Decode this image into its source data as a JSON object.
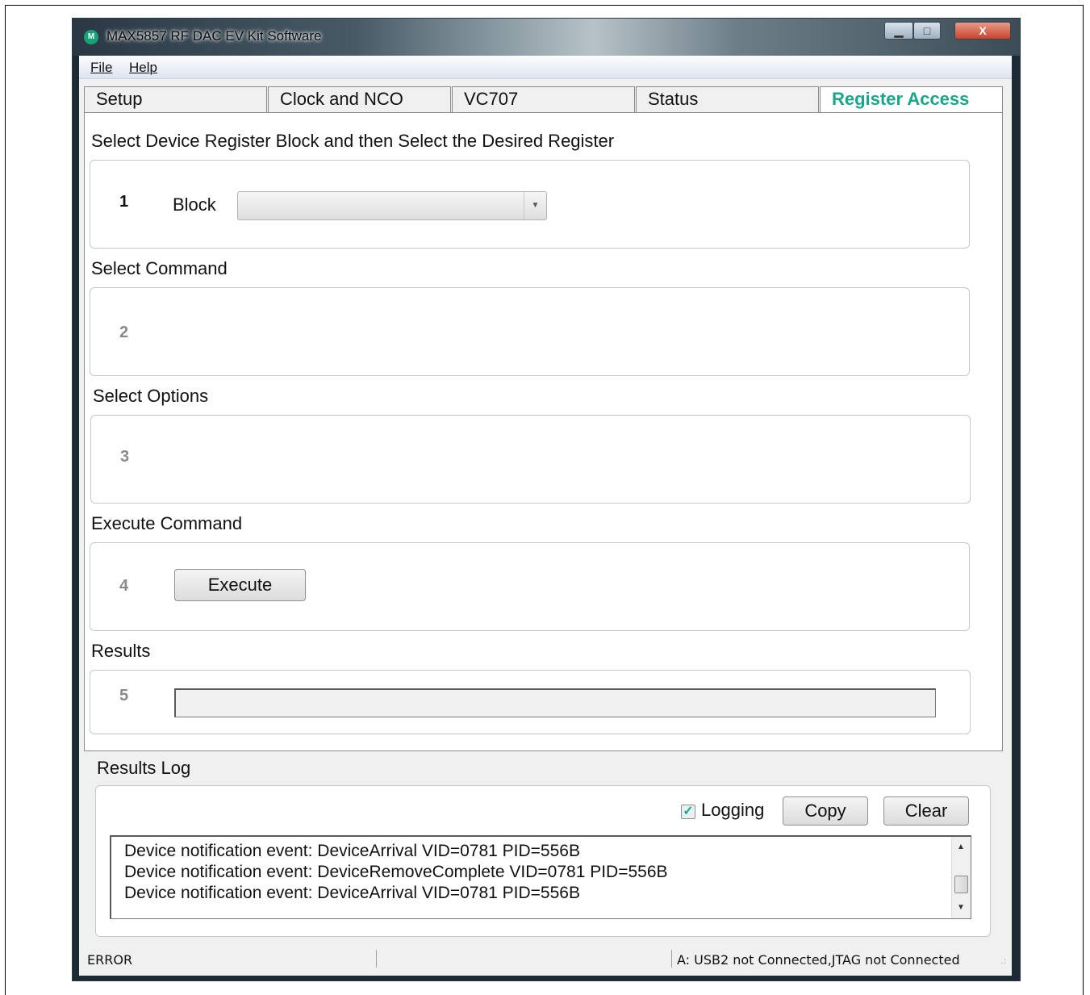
{
  "window": {
    "title": "MAX5857 RF DAC EV Kit Software",
    "icon_text": "M",
    "minimize_glyph": "▁",
    "maximize_glyph": "□",
    "close_glyph": "X"
  },
  "menu": [
    {
      "label": "File"
    },
    {
      "label": "Help"
    }
  ],
  "tabs": [
    {
      "label": "Setup",
      "active": false
    },
    {
      "label": "Clock and NCO",
      "active": false
    },
    {
      "label": "VC707",
      "active": false
    },
    {
      "label": "Status",
      "active": false
    },
    {
      "label": "Register Access",
      "active": true
    }
  ],
  "colors": {
    "accent": "#19a68a",
    "window_frame": "#1c2a33"
  },
  "register_access": {
    "step1": {
      "heading": "Select Device Register Block and then Select the Desired Register",
      "number": "1",
      "block_label": "Block",
      "block_value": ""
    },
    "step2": {
      "heading": "Select Command",
      "number": "2"
    },
    "step3": {
      "heading": "Select Options",
      "number": "3"
    },
    "step4": {
      "heading": "Execute Command",
      "number": "4",
      "execute_label": "Execute"
    },
    "step5": {
      "heading": "Results",
      "number": "5",
      "result_value": ""
    }
  },
  "results_log": {
    "heading": "Results Log",
    "logging_label": "Logging",
    "logging_checked": true,
    "copy_label": "Copy",
    "clear_label": "Clear",
    "lines": [
      "Device notification event: DeviceArrival VID=0781 PID=556B",
      "Device notification event: DeviceRemoveComplete VID=0781 PID=556B",
      "Device notification event: DeviceArrival VID=0781 PID=556B"
    ]
  },
  "statusbar": {
    "left": "ERROR",
    "middle": "",
    "right": "A: USB2 not Connected,JTAG not Connected"
  }
}
